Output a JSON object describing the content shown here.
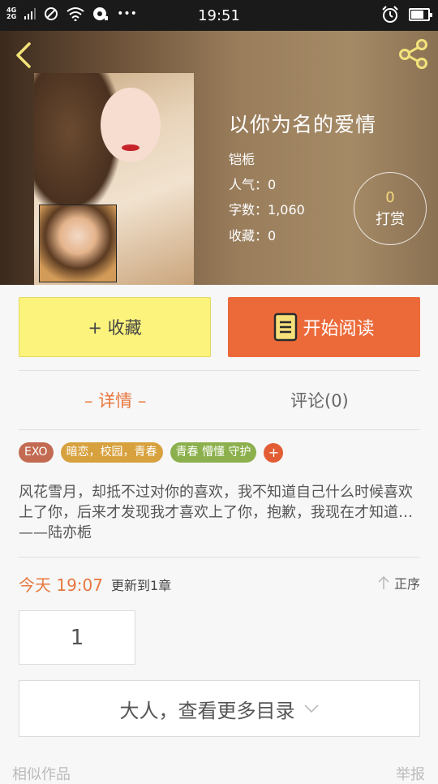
{
  "status_bar": {
    "network_top": "4G",
    "network_bottom": "2G",
    "time": "19:51",
    "more": "•••",
    "battery_level": 0.75
  },
  "book": {
    "title": "以你为名的爱情",
    "author": "铠栀",
    "popularity_label": "人气：",
    "popularity_value": "0",
    "words_label": "字数：",
    "words_value": "1,060",
    "favorites_label": "收藏：",
    "favorites_value": "0",
    "tip_count": "0",
    "tip_label": "打赏"
  },
  "actions": {
    "collect": "+ 收藏",
    "read": "开始阅读"
  },
  "tabs": {
    "detail": "– 详情 –",
    "comments": "评论(0)"
  },
  "tags": [
    "EXO",
    "暗恋，校园，青春",
    "青春 懵懂 守护",
    "+"
  ],
  "synopsis": "风花雪月，却抵不过对你的喜欢，我不知道自己什么时候喜欢上了你，后来才发现我才喜欢上了你，抱歉，我现在才知道…——陆亦栀",
  "update": {
    "time": "今天 19:07",
    "text": "更新到1章",
    "order": "正序"
  },
  "chapters": {
    "first": "1",
    "more": "大人，查看更多目录"
  },
  "footer": {
    "similar": "相似作品",
    "report": "举报"
  },
  "colors": {
    "accent": "#e8773f",
    "read_button": "#ec6a3a",
    "collect_button": "#fbf37c"
  }
}
